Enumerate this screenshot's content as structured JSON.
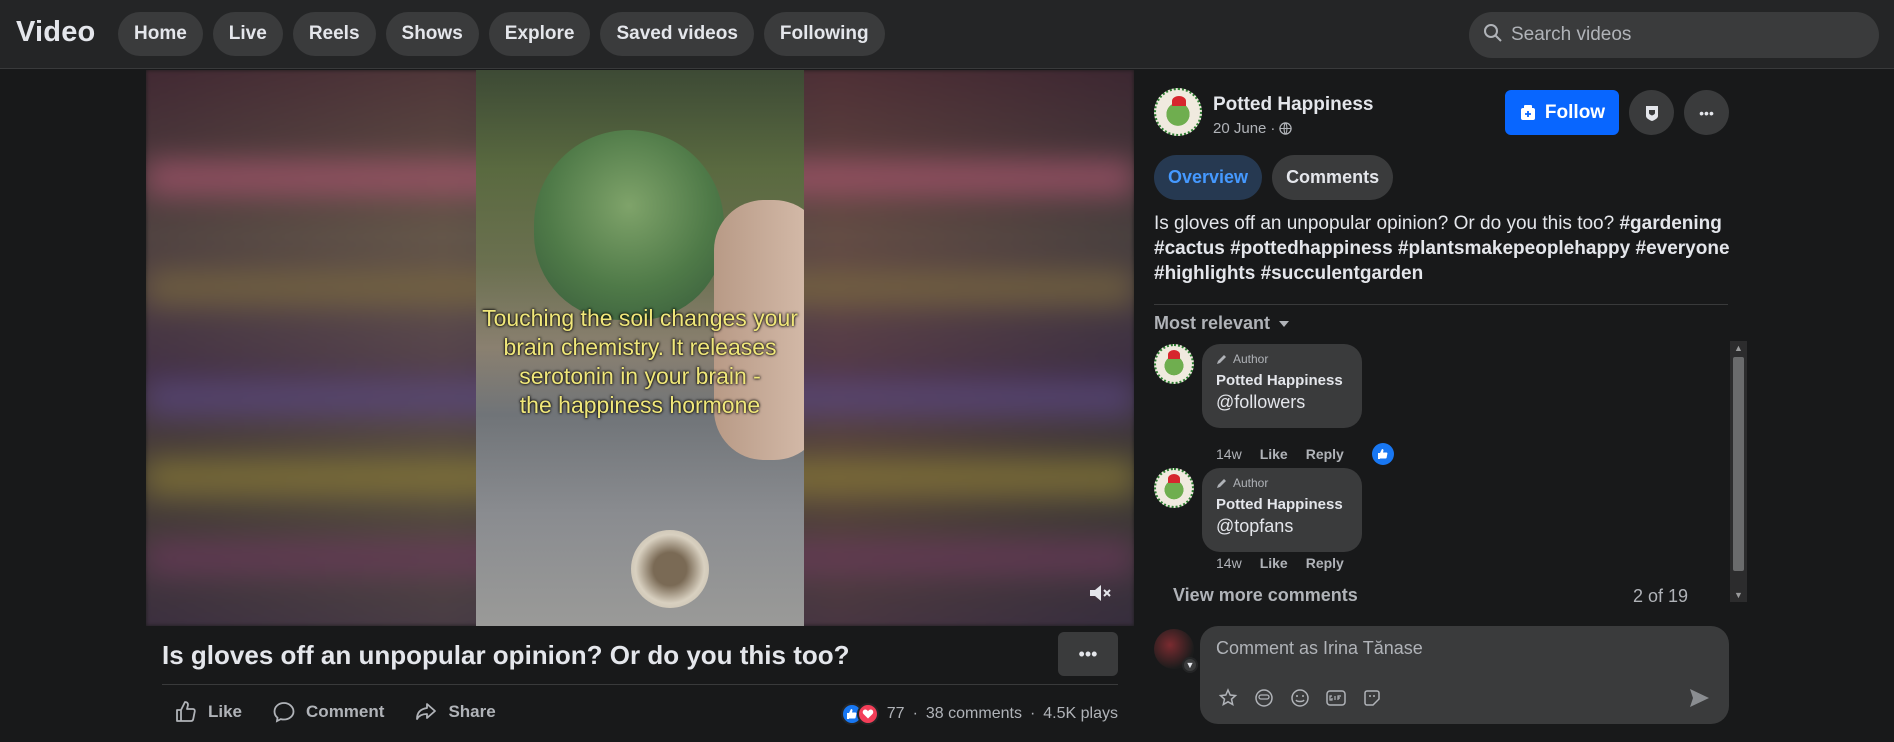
{
  "header": {
    "brand": "Video",
    "nav": [
      {
        "label": "Home"
      },
      {
        "label": "Live"
      },
      {
        "label": "Reels"
      },
      {
        "label": "Shows"
      },
      {
        "label": "Explore"
      },
      {
        "label": "Saved videos"
      },
      {
        "label": "Following"
      }
    ],
    "search_placeholder": "Search videos"
  },
  "video": {
    "caption_lines": [
      "Touching the soil changes your",
      "brain chemistry. It releases",
      "serotonin in your brain -",
      "the happiness hormone"
    ],
    "title": "Is gloves off an unpopular opinion? Or do you this too?",
    "actions": {
      "like": "Like",
      "comment": "Comment",
      "share": "Share"
    },
    "stats": {
      "reactions": "77",
      "comments": "38 comments",
      "plays": "4.5K plays"
    },
    "muted": true
  },
  "page": {
    "name": "Potted Happiness",
    "date": "20 June",
    "follow_label": "Follow"
  },
  "tabs": [
    {
      "label": "Overview",
      "active": true
    },
    {
      "label": "Comments",
      "active": false
    }
  ],
  "description": {
    "text": "Is gloves off an unpopular opinion? Or do you this too?",
    "hashtags": [
      "#gardening",
      "#cactus",
      "#pottedhappiness",
      "#plantsmakepeoplehappy",
      "#everyone",
      "#highlights",
      "#succulentgarden"
    ]
  },
  "comments": {
    "sort_label": "Most relevant",
    "items": [
      {
        "badge": "Author",
        "author": "Potted Happiness",
        "text": "@followers",
        "time": "14w",
        "like": "Like",
        "reply": "Reply",
        "has_reaction": true
      },
      {
        "badge": "Author",
        "author": "Potted Happiness",
        "text": "@topfans",
        "time": "14w",
        "like": "Like",
        "reply": "Reply",
        "has_reaction": false
      }
    ],
    "view_more": "View more comments",
    "count": "2 of 19",
    "composer_placeholder": "Comment as Irina Tănase"
  },
  "colors": {
    "background": "#18191a",
    "surface": "#242526",
    "pill": "#3a3b3c",
    "accent": "#0866ff",
    "tab_active_text": "#4599ff",
    "caption": "#f0e77a"
  }
}
